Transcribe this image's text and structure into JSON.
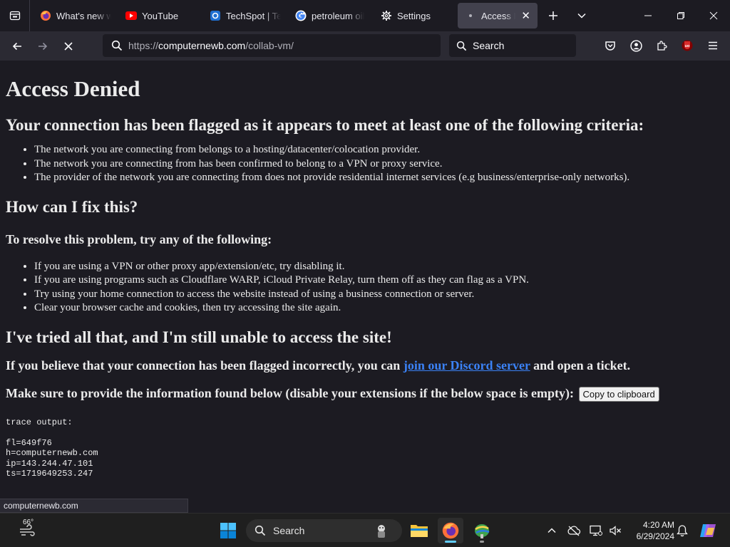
{
  "tabs": [
    {
      "label": "What's new wi",
      "icon": "firefox-icon"
    },
    {
      "label": "YouTube",
      "icon": "youtube-icon"
    },
    {
      "label": "TechSpot | Tec",
      "icon": "techspot-icon"
    },
    {
      "label": "petroleum oil",
      "icon": "google-icon"
    },
    {
      "label": "Settings",
      "icon": "gear-icon"
    },
    {
      "label": "Access Deni",
      "icon": "loading-dot-icon"
    }
  ],
  "urlbar": {
    "scheme": "https://",
    "host": "computernewb.com",
    "path": "/collab-vm/"
  },
  "searchbar": {
    "placeholder": "Search"
  },
  "page": {
    "title": "Access Denied",
    "flagged_heading": "Your connection has been flagged as it appears to meet at least one of the following criteria:",
    "criteria": [
      "The network you are connecting from belongs to a hosting/datacenter/colocation provider.",
      "The network you are connecting from has been confirmed to belong to a VPN or proxy service.",
      "The provider of the network you are connecting from does not provide residential internet services (e.g business/enterprise-only networks)."
    ],
    "fix_heading": "How can I fix this?",
    "resolve_heading": "To resolve this problem, try any of the following:",
    "fixes": [
      "If you are using a VPN or other proxy app/extension/etc, try disabling it.",
      "If you are using programs such as Cloudflare WARP, iCloud Private Relay, turn them off as they can flag as a VPN.",
      "Try using your home connection to access the website instead of using a business connection or server.",
      "Clear your browser cache and cookies, then try accessing the site again."
    ],
    "still_heading": "I've tried all that, and I'm still unable to access the site!",
    "believe_prefix": "If you believe that your connection has been flagged incorrectly, you can ",
    "discord_link": "join our Discord server",
    "believe_suffix": " and open a ticket.",
    "provide_text": "Make sure to provide the information found below (disable your extensions if the below space is empty): ",
    "copy_button": "Copy to clipboard",
    "trace_label": "trace output:",
    "trace_lines": [
      "fl=649f76",
      "h=computernewb.com",
      "ip=143.244.47.101",
      "ts=1719649253.247"
    ]
  },
  "status_link": "computernewb.com",
  "taskbar": {
    "weather_temp": "66°",
    "search_placeholder": "Search",
    "time": "4:20 AM",
    "date": "6/29/2024"
  },
  "colors": {
    "accent": "#60cdff",
    "link": "#3b82f6",
    "page_bg": "#1c1b22",
    "toolbar_bg": "#2b2a33"
  }
}
